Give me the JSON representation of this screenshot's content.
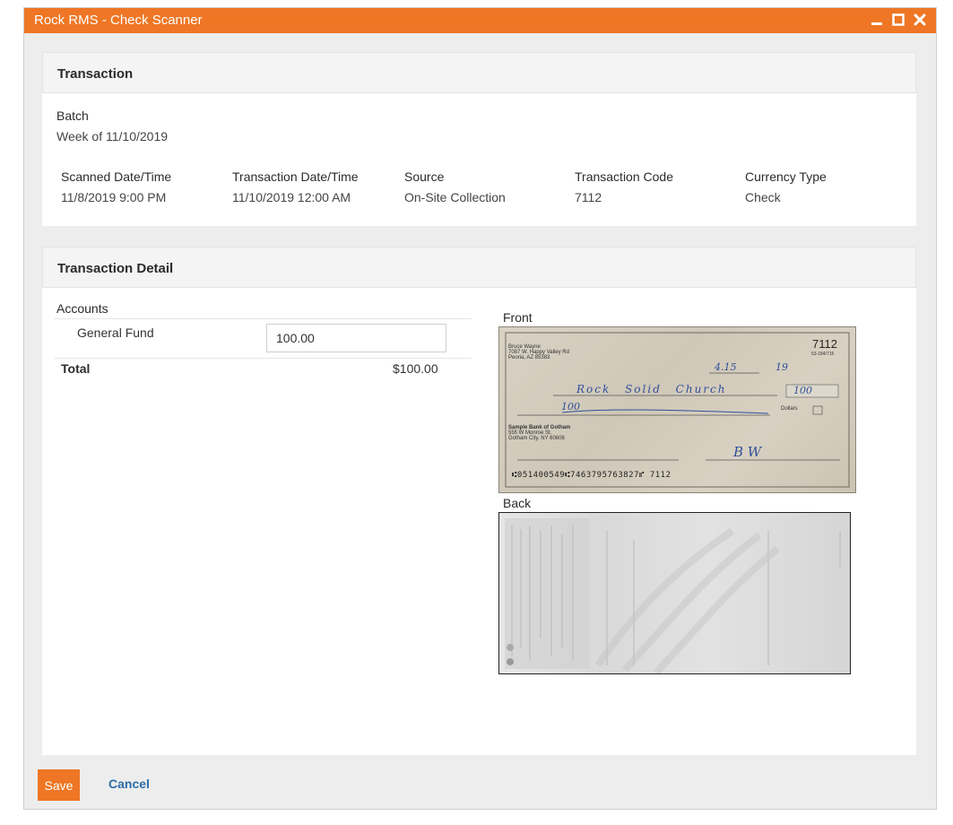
{
  "window": {
    "title": "Rock RMS - Check Scanner"
  },
  "transaction": {
    "heading": "Transaction",
    "batch_label": "Batch",
    "batch_value": "Week of 11/10/2019",
    "fields": [
      {
        "label": "Scanned Date/Time",
        "value": "11/8/2019 9:00 PM"
      },
      {
        "label": "Transaction Date/Time",
        "value": "11/10/2019 12:00 AM"
      },
      {
        "label": "Source",
        "value": "On-Site Collection"
      },
      {
        "label": "Transaction Code",
        "value": "7112"
      },
      {
        "label": "Currency Type",
        "value": "Check"
      }
    ]
  },
  "detail": {
    "heading": "Transaction Detail",
    "accounts_label": "Accounts",
    "account_name": "General Fund",
    "account_amount": "100.00",
    "total_label": "Total",
    "total_value": "$100.00",
    "front_label": "Front",
    "back_label": "Back"
  },
  "check_image": {
    "payer_name": "Bruce Wayne",
    "payer_address1": "7087 W. Happy Valley Rd",
    "payer_address2": "Peoria, AZ 85383",
    "check_number": "7112",
    "routing_fraction": "53-184/715",
    "date_written": "4.15",
    "date_year": "19",
    "payee_written": "Rock Solid Church",
    "amount_written": "100",
    "amount_words": "100",
    "dollars_text": "Dollars",
    "bank_name": "Sample Bank of Gotham",
    "bank_address1": "555 W Monroe St.",
    "bank_address2": "Gotham City, NY 60606",
    "signature": "B W",
    "micr": "⑆051400549⑆7463795763827⑈ 7112"
  },
  "actions": {
    "save_label": "Save",
    "cancel_label": "Cancel"
  },
  "colors": {
    "accent": "#ee7624",
    "link": "#2a6da8",
    "panel_header": "#f4f4f4",
    "page_bg": "#ededed"
  }
}
